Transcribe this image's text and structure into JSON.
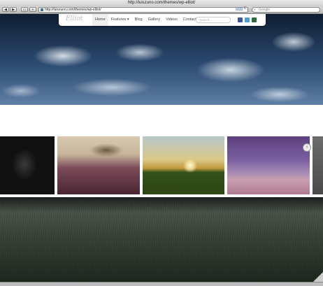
{
  "window": {
    "title": "http://luiszuno.com/themes/wp-elliot/"
  },
  "toolbar": {
    "back_label": "◀",
    "forward_label": "▶",
    "bookmarks_label": "▭",
    "add_label": "+",
    "url": "http://luiszuno.com/themes/wp-elliot/",
    "rss_label": "RSS",
    "reload_label": "c",
    "search_placeholder": "Google"
  },
  "site": {
    "logo_text": "Elliot",
    "nav": [
      "Home",
      "Features ▾",
      "Blog",
      "Gallery",
      "Videos",
      "Contact"
    ],
    "search_placeholder": "Search...",
    "social_colors": {
      "facebook": "#3b5998",
      "twitter": "#4aa0d5",
      "other": "#2e6b3a"
    }
  },
  "carousel": {
    "next_label": "›"
  }
}
